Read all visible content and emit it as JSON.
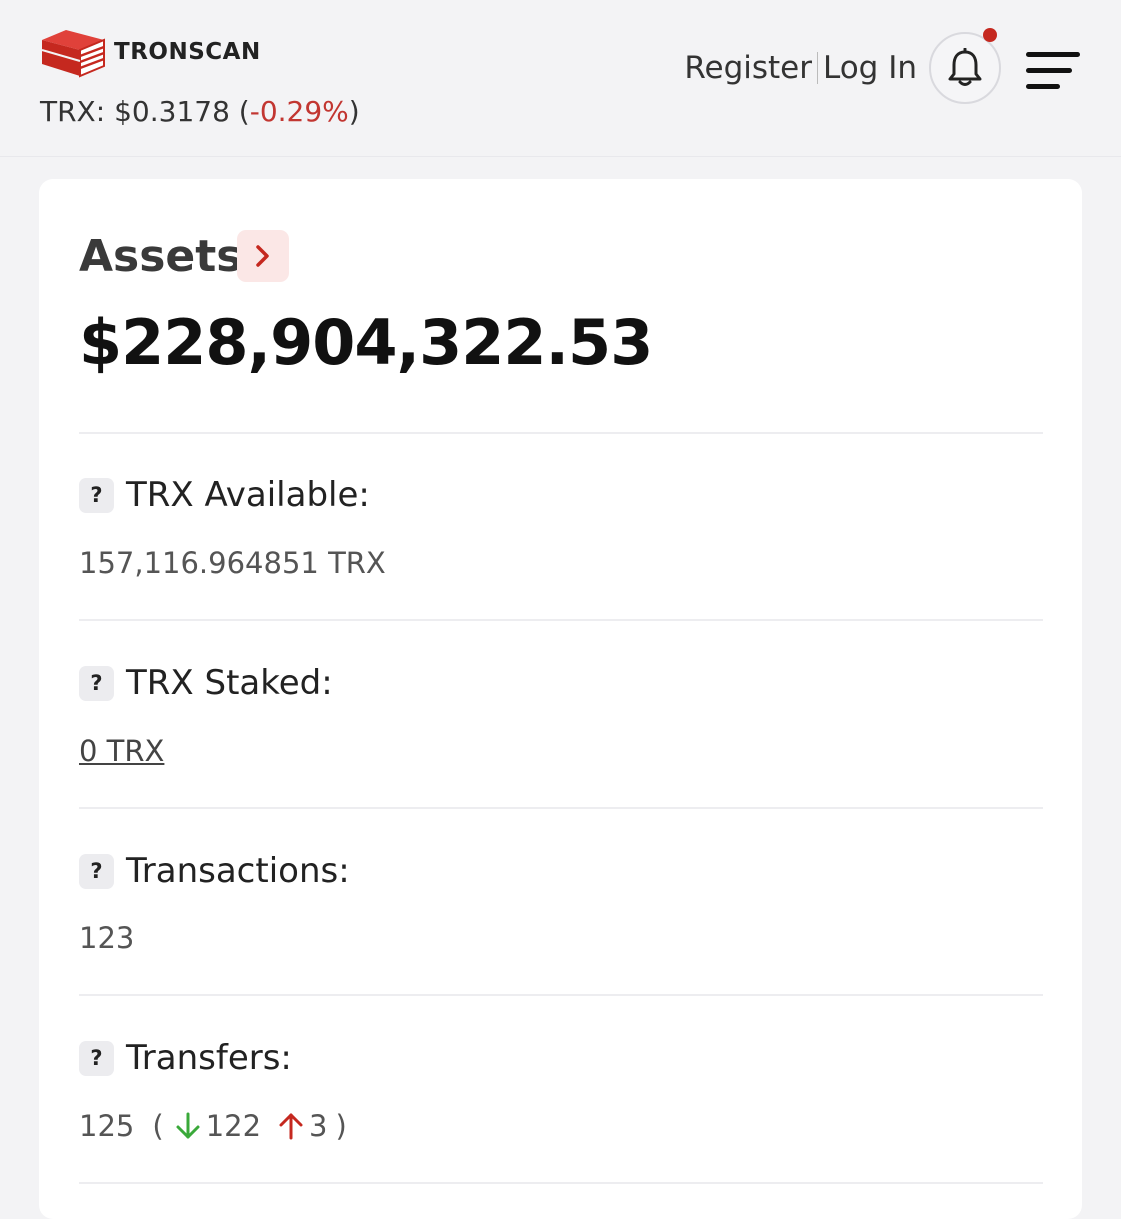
{
  "header": {
    "brand": "TRONSCAN",
    "price_label": "TRX:",
    "price_value": "$0.3178",
    "price_open": "(",
    "price_change": "-0.29%",
    "price_close": ")",
    "register_label": "Register",
    "login_label": "Log In",
    "notification_icon": "bell-icon",
    "menu_icon": "hamburger-menu-icon"
  },
  "colors": {
    "brand_red": "#c5281f",
    "negative": "#c23631",
    "positive": "#3aa93a"
  },
  "assets": {
    "title": "Assets",
    "total": "$228,904,322.53"
  },
  "rows": [
    {
      "label": "TRX Available:",
      "value": "157,116.964851 TRX"
    },
    {
      "label": "TRX Staked:",
      "value": "0 TRX"
    },
    {
      "label": "Transactions:",
      "value": "123"
    },
    {
      "label": "Transfers:",
      "value": "125"
    }
  ],
  "transfers": {
    "open": "(",
    "incoming": "122",
    "outgoing": "3",
    "close": ")"
  }
}
